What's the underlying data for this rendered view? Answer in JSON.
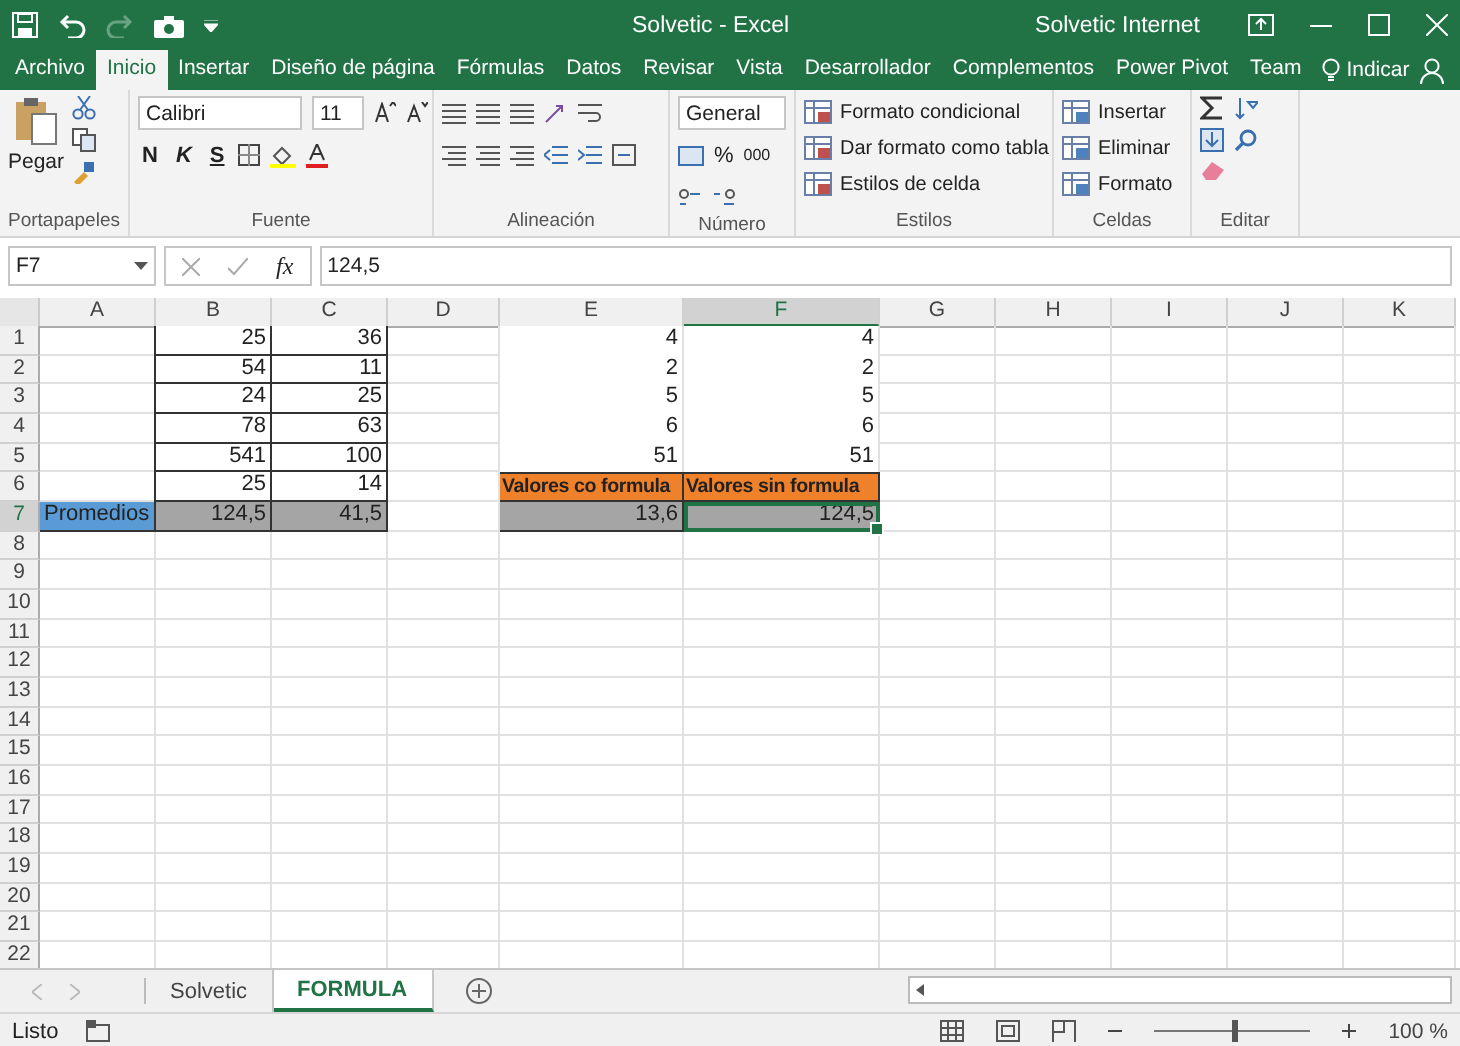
{
  "window": {
    "title": "Solvetic  -  Excel",
    "account": "Solvetic Internet"
  },
  "ribbon_tabs": [
    {
      "label": "Archivo",
      "selected": false
    },
    {
      "label": "Inicio",
      "selected": true
    },
    {
      "label": "Insertar",
      "selected": false
    },
    {
      "label": "Diseño de página",
      "selected": false
    },
    {
      "label": "Fórmulas",
      "selected": false
    },
    {
      "label": "Datos",
      "selected": false
    },
    {
      "label": "Revisar",
      "selected": false
    },
    {
      "label": "Vista",
      "selected": false
    },
    {
      "label": "Desarrollador",
      "selected": false
    },
    {
      "label": "Complementos",
      "selected": false
    },
    {
      "label": "Power Pivot",
      "selected": false
    },
    {
      "label": "Team",
      "selected": false
    }
  ],
  "tell_me": "Indicar",
  "ribbon_groups": [
    {
      "kind": "clipboard",
      "label": "Portapapeles",
      "paste": "Pegar"
    },
    {
      "kind": "font",
      "label": "Fuente",
      "font": "Calibri",
      "size": "11",
      "bold": "N",
      "italic": "K",
      "underline": "S"
    },
    {
      "kind": "alignment",
      "label": "Alineación"
    },
    {
      "kind": "number",
      "label": "Número",
      "format": "General",
      "percent": "%",
      "thousands": "000"
    },
    {
      "kind": "styles",
      "label": "Estilos",
      "commands": [
        "Formato condicional",
        "Dar formato como tabla",
        "Estilos de celda"
      ]
    },
    {
      "kind": "cells",
      "label": "Celdas",
      "commands": [
        "Insertar",
        "Eliminar",
        "Formato"
      ]
    },
    {
      "kind": "editing",
      "label": "Editar"
    }
  ],
  "formula_bar": {
    "name_box": "F7",
    "fx": "fx",
    "value": "124,5"
  },
  "columns": [
    {
      "label": "A",
      "selected": false
    },
    {
      "label": "B",
      "selected": false
    },
    {
      "label": "C",
      "selected": false
    },
    {
      "label": "D",
      "selected": false
    },
    {
      "label": "E",
      "selected": false
    },
    {
      "label": "F",
      "selected": true
    },
    {
      "label": "G",
      "selected": false
    },
    {
      "label": "H",
      "selected": false
    },
    {
      "label": "I",
      "selected": false
    },
    {
      "label": "J",
      "selected": false
    },
    {
      "label": "K",
      "selected": false
    }
  ],
  "rows": [
    {
      "number": "1",
      "selected": false,
      "cells": {
        "B": {
          "text": "25",
          "kind": "boxed"
        },
        "C": {
          "text": "36",
          "kind": "boxed"
        },
        "E": {
          "text": "4",
          "kind": "plain"
        },
        "F": {
          "text": "4",
          "kind": "plain"
        }
      }
    },
    {
      "number": "2",
      "selected": false,
      "cells": {
        "B": {
          "text": "54",
          "kind": "boxed"
        },
        "C": {
          "text": "11",
          "kind": "boxed"
        },
        "E": {
          "text": "2",
          "kind": "plain"
        },
        "F": {
          "text": "2",
          "kind": "plain"
        }
      }
    },
    {
      "number": "3",
      "selected": false,
      "cells": {
        "B": {
          "text": "24",
          "kind": "boxed"
        },
        "C": {
          "text": "25",
          "kind": "boxed"
        },
        "E": {
          "text": "5",
          "kind": "plain"
        },
        "F": {
          "text": "5",
          "kind": "plain"
        }
      }
    },
    {
      "number": "4",
      "selected": false,
      "cells": {
        "B": {
          "text": "78",
          "kind": "boxed"
        },
        "C": {
          "text": "63",
          "kind": "boxed"
        },
        "E": {
          "text": "6",
          "kind": "plain"
        },
        "F": {
          "text": "6",
          "kind": "plain"
        }
      }
    },
    {
      "number": "5",
      "selected": false,
      "cells": {
        "B": {
          "text": "541",
          "kind": "boxed"
        },
        "C": {
          "text": "100",
          "kind": "boxed"
        },
        "E": {
          "text": "51",
          "kind": "plain"
        },
        "F": {
          "text": "51",
          "kind": "plain"
        }
      }
    },
    {
      "number": "6",
      "selected": false,
      "cells": {
        "B": {
          "text": "25",
          "kind": "boxed"
        },
        "C": {
          "text": "14",
          "kind": "boxed"
        },
        "E": {
          "text": "Valores co formula",
          "kind": "header"
        },
        "F": {
          "text": "Valores sin formula",
          "kind": "header"
        }
      }
    },
    {
      "number": "7",
      "selected": true,
      "cells": {
        "A": {
          "text": "Promedios",
          "kind": "label"
        },
        "B": {
          "text": "124,5",
          "kind": "total"
        },
        "C": {
          "text": "41,5",
          "kind": "total"
        },
        "E": {
          "text": "13,6",
          "kind": "total"
        },
        "F": {
          "text": "124,5",
          "kind": "total"
        }
      }
    },
    {
      "number": "8",
      "selected": false
    },
    {
      "number": "9",
      "selected": false
    },
    {
      "number": "10",
      "selected": false
    },
    {
      "number": "11",
      "selected": false
    },
    {
      "number": "12",
      "selected": false
    },
    {
      "number": "13",
      "selected": false
    },
    {
      "number": "14",
      "selected": false
    },
    {
      "number": "15",
      "selected": false
    },
    {
      "number": "16",
      "selected": false
    },
    {
      "number": "17",
      "selected": false
    },
    {
      "number": "18",
      "selected": false
    },
    {
      "number": "19",
      "selected": false
    },
    {
      "number": "20",
      "selected": false
    },
    {
      "number": "21",
      "selected": false
    },
    {
      "number": "22",
      "selected": false
    }
  ],
  "sheets": [
    {
      "label": "Solvetic",
      "selected": false
    },
    {
      "label": "FORMULA",
      "selected": true
    }
  ],
  "status_bar": {
    "status": "Listo",
    "zoom": "100 %",
    "zoom_slider": {
      "level": 0.5
    }
  }
}
